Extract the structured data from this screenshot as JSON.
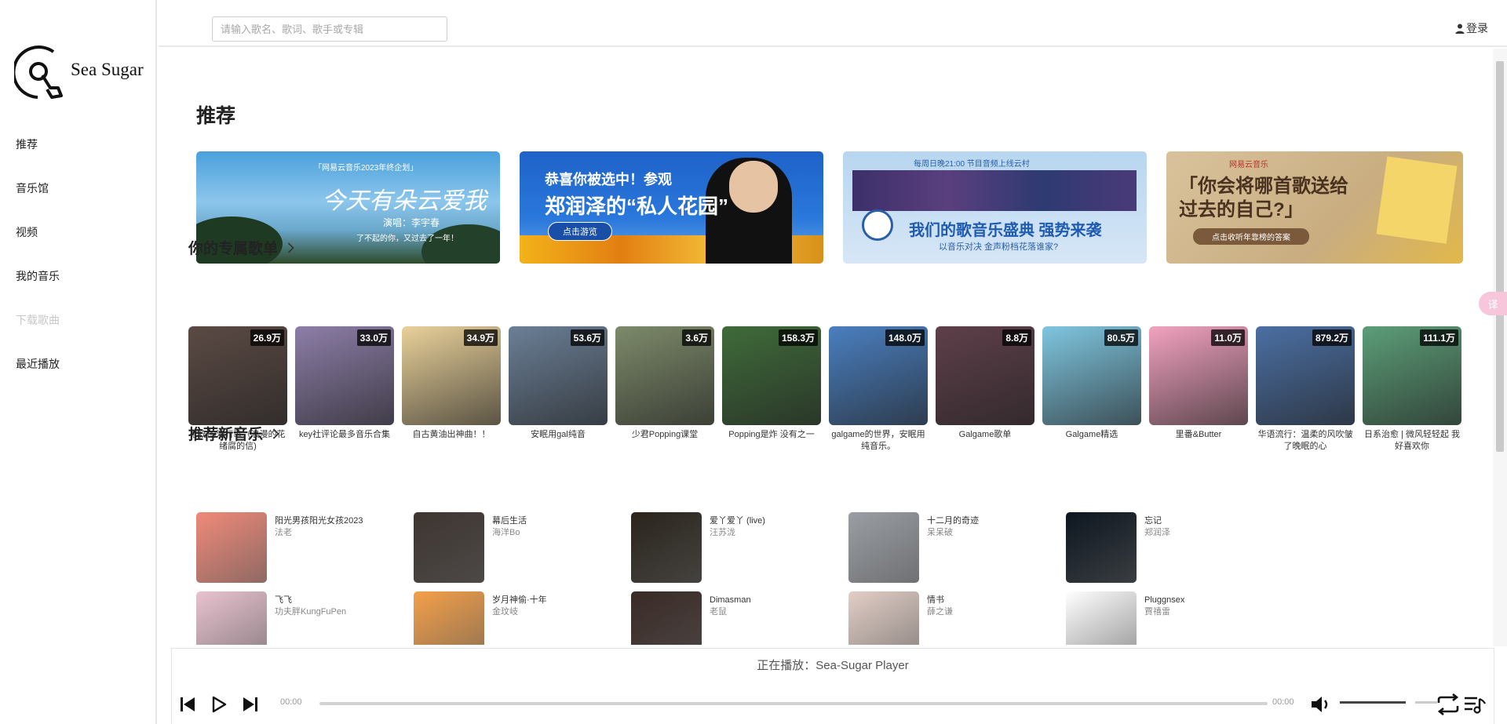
{
  "app": {
    "logo_text": "Sea Sugar"
  },
  "sidebar": {
    "items": [
      {
        "label": "推荐",
        "disabled": false
      },
      {
        "label": "音乐馆",
        "disabled": false
      },
      {
        "label": "视频",
        "disabled": false
      },
      {
        "label": "我的音乐",
        "disabled": false
      },
      {
        "label": "下载歌曲",
        "disabled": true
      },
      {
        "label": "最近播放",
        "disabled": false
      }
    ]
  },
  "header": {
    "search_placeholder": "请输入歌名、歌词、歌手或专辑",
    "login_label": "登录"
  },
  "main": {
    "title": "推荐",
    "banners": [
      {
        "tag": "「网易云音乐2023年终企划」",
        "headline": "今天有朵云爱我",
        "sub": "演唱：李宇春",
        "caption": "了不起的你，又过去了一年！"
      },
      {
        "headline_1": "恭喜你被选中！参观",
        "headline_2": "郑润泽的“私人花园”",
        "button": "点击游览"
      },
      {
        "top": "每周日晚21:00 节目音频上线云村",
        "headline": "我们的歌音乐盛典 强势来袭",
        "sub": "以音乐对决 金声粉档花落谁家?"
      },
      {
        "brand": "网易云音乐",
        "headline": "「你会将哪首歌送给过去的自己?」",
        "button": "点击收听年靠榜的答案"
      }
    ],
    "playlists_title": "你的专属歌单",
    "playlists": [
      {
        "count": "26.9万",
        "name": "悲伤的流行歌（浪漫的花绪腐的信)",
        "color": "#5b4a44"
      },
      {
        "count": "33.0万",
        "name": "key社评论最多音乐合集",
        "color": "#8d7ea8"
      },
      {
        "count": "34.9万",
        "name": "自古黄油出神曲！！",
        "color": "#e9d19a"
      },
      {
        "count": "53.6万",
        "name": "安眠用gal纯音",
        "color": "#6b7f96"
      },
      {
        "count": "3.6万",
        "name": "少君Popping课堂",
        "color": "#7d8a6a"
      },
      {
        "count": "158.3万",
        "name": "Popping是炸 没有之一",
        "color": "#3f6b3a"
      },
      {
        "count": "148.0万",
        "name": "galgame的世界，安眠用纯音乐。",
        "color": "#4a7fc0"
      },
      {
        "count": "8.8万",
        "name": "Galgame歌单",
        "color": "#5e3f4a"
      },
      {
        "count": "80.5万",
        "name": "Galgame精选",
        "color": "#7fc6e0"
      },
      {
        "count": "11.0万",
        "name": "里番&Butter",
        "color": "#f2a2bf"
      },
      {
        "count": "879.2万",
        "name": "华语流行：温柔的风吹皱了晚眠的心",
        "color": "#4b6fa3"
      },
      {
        "count": "111.1万",
        "name": "日系治愈 | 微风轻轻起 我好喜欢你",
        "color": "#5c9e78"
      }
    ],
    "new_music_title": "推荐新音乐",
    "songs": [
      {
        "title": "阳光男孩阳光女孩2023",
        "artist": "法老",
        "color": "#f08a7a"
      },
      {
        "title": "幕后生活",
        "artist": "海洋Bo",
        "color": "#3e3530"
      },
      {
        "title": "爱丫爱丫 (live)",
        "artist": "汪苏泷",
        "color": "#2a241c"
      },
      {
        "title": "十二月的奇迹",
        "artist": "呆呆破",
        "color": "#9a9ea4"
      },
      {
        "title": "忘记",
        "artist": "郑润泽",
        "color": "#0d1620"
      },
      {
        "title": "飞飞",
        "artist": "功夫胖KungFuPen",
        "color": "#e9c3cf"
      },
      {
        "title": "岁月神偷·十年",
        "artist": "金玟岐",
        "color": "#f4a04a"
      },
      {
        "title": "Dimasman",
        "artist": "老鼠",
        "color": "#3a2a26"
      },
      {
        "title": "情书",
        "artist": "薛之谦",
        "color": "#e2cec6"
      },
      {
        "title": "Pluggnsex",
        "artist": "賈禧雷",
        "color": "#ffffff"
      }
    ]
  },
  "player": {
    "now_playing": "正在播放：Sea-Sugar Player",
    "current_time": "00:00",
    "total_time": "00:00",
    "progress": 0,
    "volume": 0.68
  },
  "translate_button": "译"
}
